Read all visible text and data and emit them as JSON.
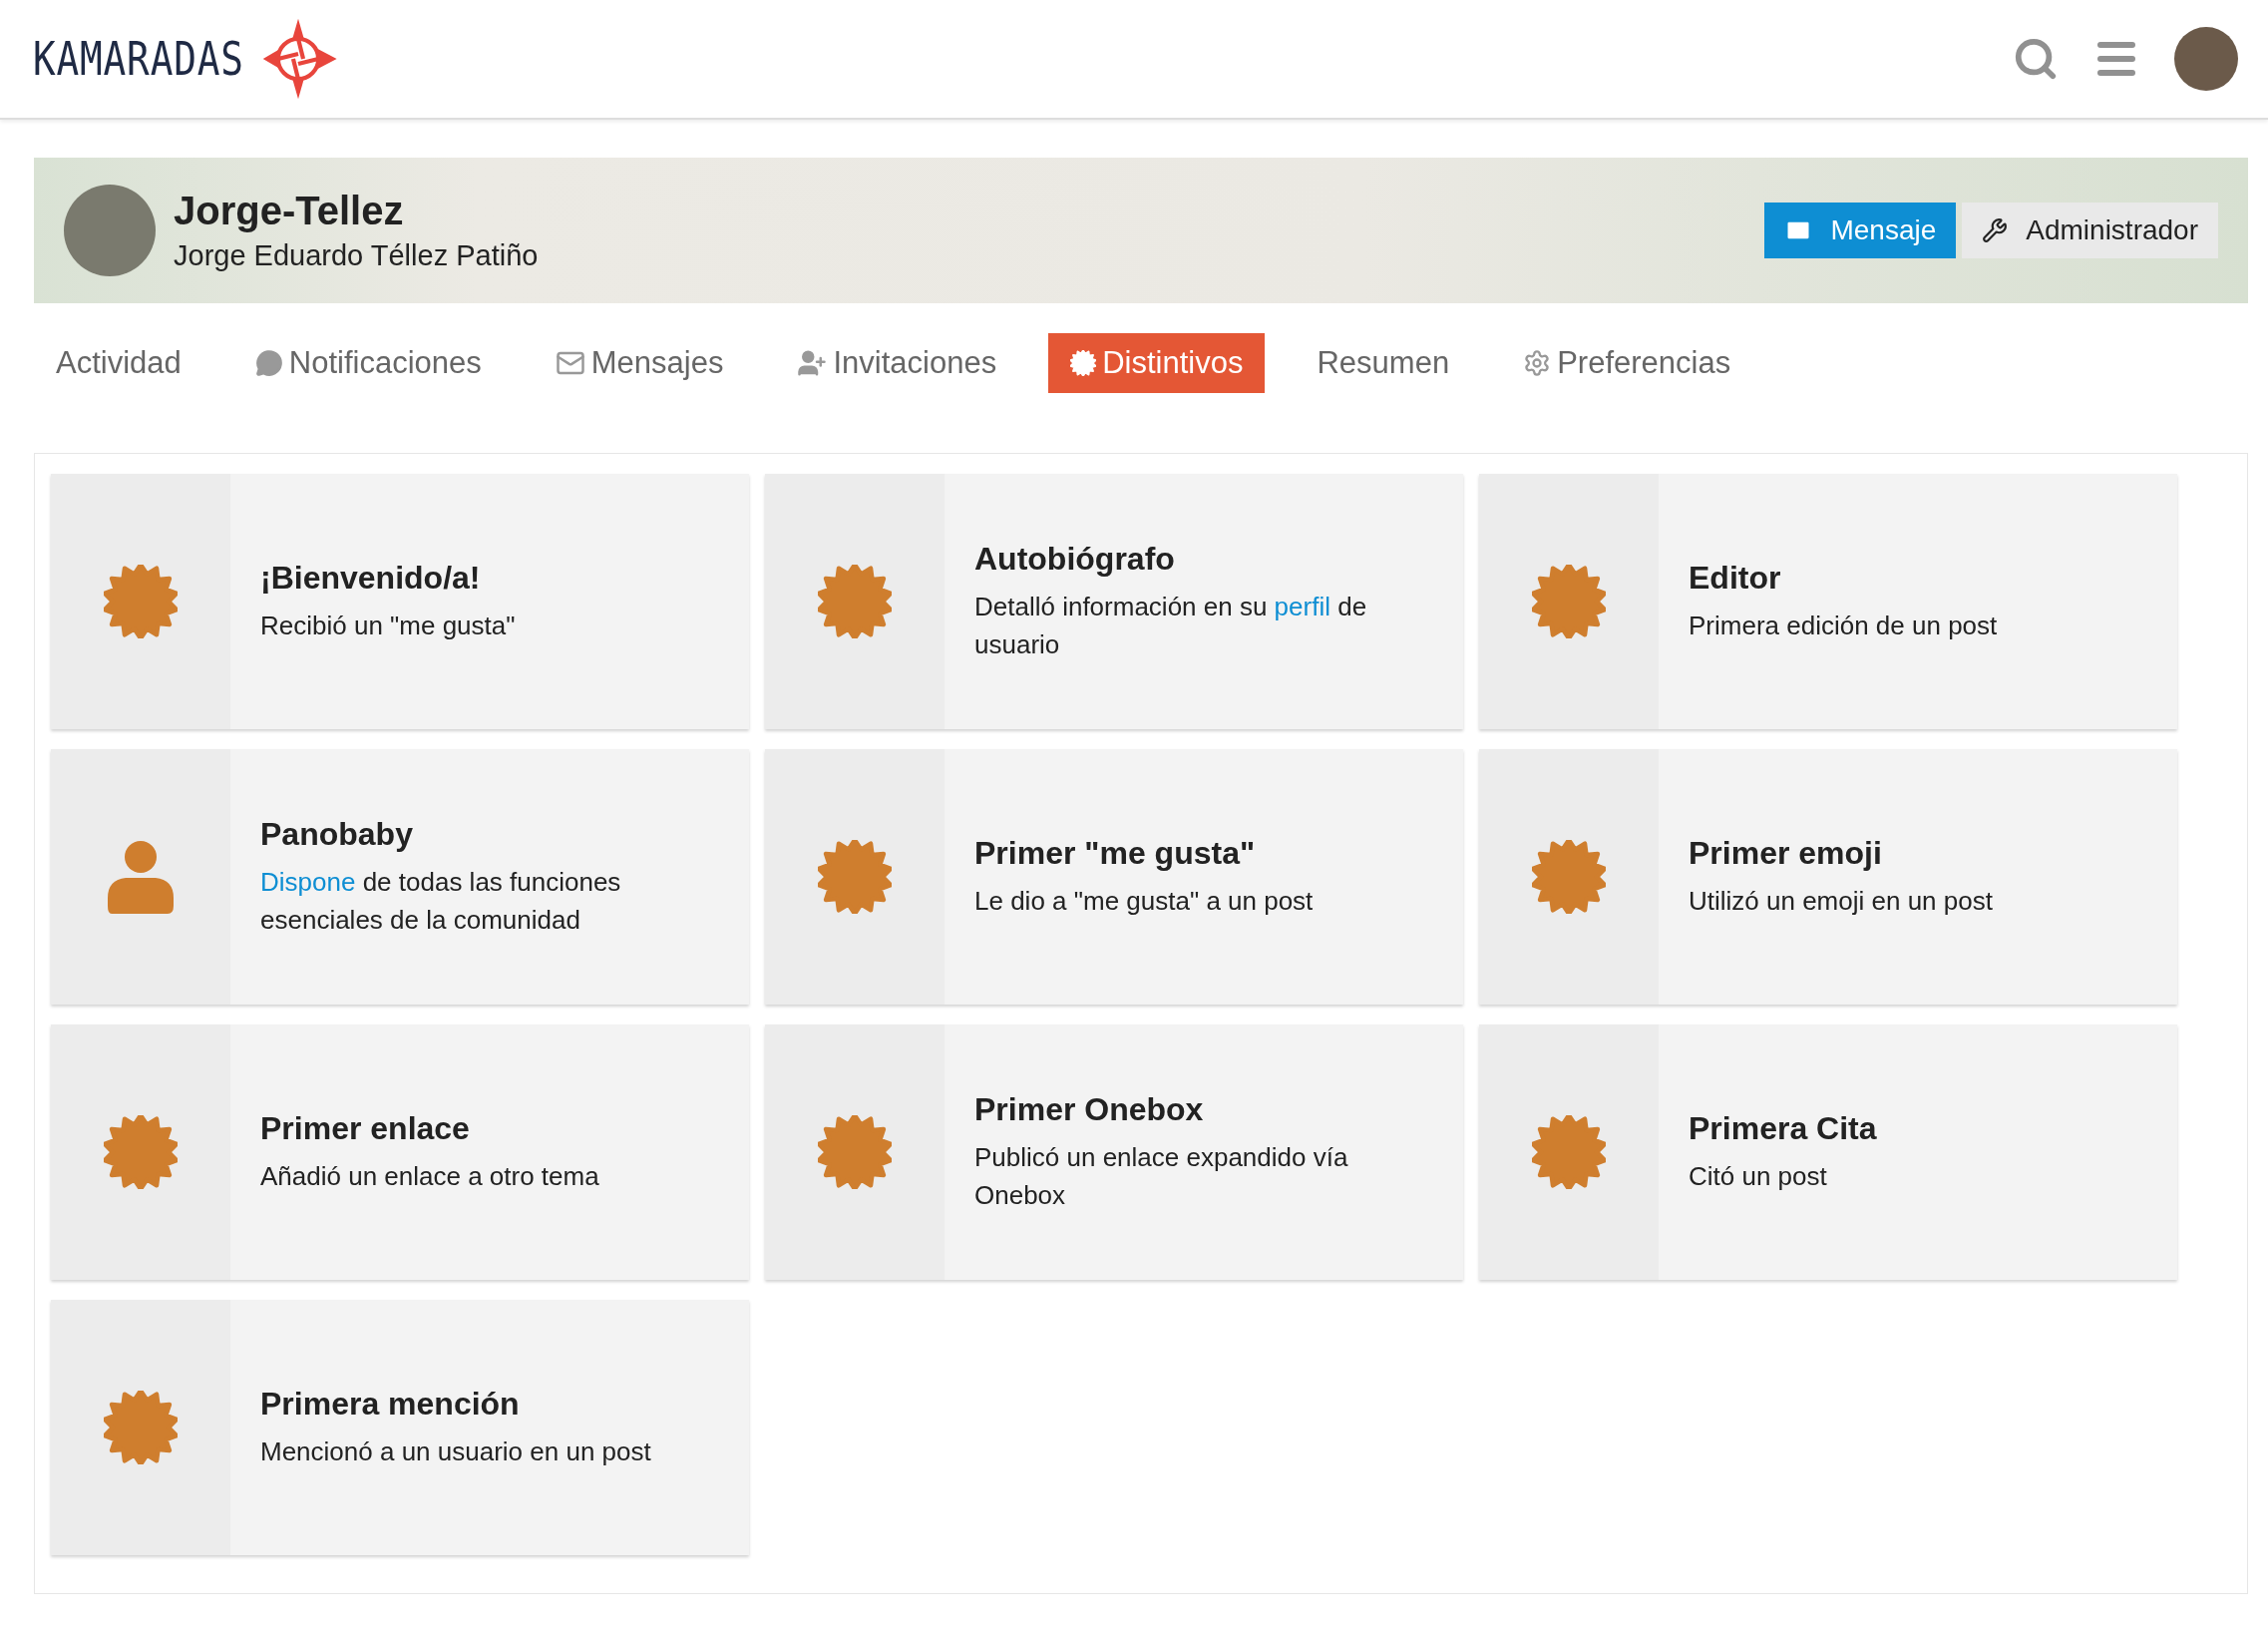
{
  "header": {
    "logo_text": "KAMARADAS"
  },
  "profile": {
    "username": "Jorge-Tellez",
    "full_name": "Jorge Eduardo Téllez Patiño",
    "buttons": [
      {
        "label": "Mensaje",
        "kind": "primary"
      },
      {
        "label": "Administrador",
        "kind": "secondary"
      }
    ]
  },
  "tabs": [
    {
      "label": "Actividad",
      "kind": "plain",
      "selected": false
    },
    {
      "label": "Notificaciones",
      "kind": "notifications",
      "selected": false
    },
    {
      "label": "Mensajes",
      "kind": "messages",
      "selected": false
    },
    {
      "label": "Invitaciones",
      "kind": "invites",
      "selected": false
    },
    {
      "label": "Distintivos",
      "kind": "badges",
      "selected": true
    },
    {
      "label": "Resumen",
      "kind": "plain",
      "selected": false
    },
    {
      "label": "Preferencias",
      "kind": "preferences",
      "selected": false
    }
  ],
  "badges": [
    {
      "title": "¡Bienvenido/a!",
      "kind": "award",
      "description": [
        {
          "kind": "text",
          "text": "Recibió un \"me gusta\""
        }
      ]
    },
    {
      "title": "Autobiógrafo",
      "kind": "award",
      "description": [
        {
          "kind": "text",
          "text": "Detalló información en su "
        },
        {
          "kind": "link",
          "text": "perfil"
        },
        {
          "kind": "text",
          "text": " de usuario"
        }
      ]
    },
    {
      "title": "Editor",
      "kind": "award",
      "description": [
        {
          "kind": "text",
          "text": "Primera edición de un post"
        }
      ]
    },
    {
      "title": "Panobaby",
      "kind": "level",
      "description": [
        {
          "kind": "link",
          "text": "Dispone"
        },
        {
          "kind": "text",
          "text": " de todas las funciones esenciales de la comunidad"
        }
      ]
    },
    {
      "title": "Primer \"me gusta\"",
      "kind": "award",
      "description": [
        {
          "kind": "text",
          "text": "Le dio a \"me gusta\" a un post"
        }
      ]
    },
    {
      "title": "Primer emoji",
      "kind": "award",
      "description": [
        {
          "kind": "text",
          "text": "Utilizó un emoji en un post"
        }
      ]
    },
    {
      "title": "Primer enlace",
      "kind": "award",
      "description": [
        {
          "kind": "text",
          "text": "Añadió un enlace a otro tema"
        }
      ]
    },
    {
      "title": "Primer Onebox",
      "kind": "award",
      "description": [
        {
          "kind": "text",
          "text": "Publicó un enlace expandido vía Onebox"
        }
      ]
    },
    {
      "title": "Primera Cita",
      "kind": "award",
      "description": [
        {
          "kind": "text",
          "text": "Citó un post"
        }
      ]
    },
    {
      "title": "Primera mención",
      "kind": "award",
      "description": [
        {
          "kind": "text",
          "text": "Mencionó a un usuario en un post"
        }
      ]
    }
  ]
}
